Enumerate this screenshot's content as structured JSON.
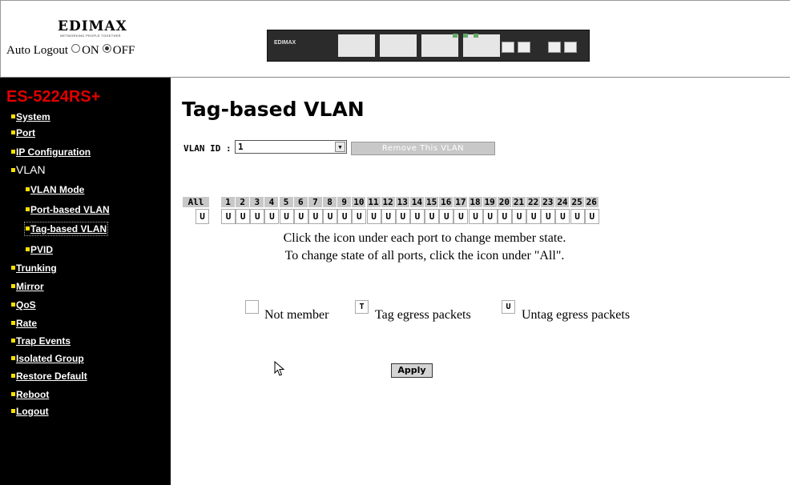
{
  "header": {
    "logo_text": "EDIMAX",
    "logo_tagline": "NETWORKING PEOPLE TOGETHER",
    "auto_logout_label": "Auto Logout",
    "on_label": "ON",
    "off_label": "OFF",
    "auto_logout_value": "OFF"
  },
  "sidebar": {
    "model": "ES-5224RS+",
    "items": [
      {
        "label": "System"
      },
      {
        "label": "Port"
      },
      {
        "label": "IP Configuration"
      },
      {
        "label": "VLAN"
      },
      {
        "label": "VLAN Mode"
      },
      {
        "label": "Port-based VLAN"
      },
      {
        "label": "Tag-based VLAN"
      },
      {
        "label": "PVID"
      },
      {
        "label": "Trunking"
      },
      {
        "label": "Mirror"
      },
      {
        "label": "QoS"
      },
      {
        "label": "Rate"
      },
      {
        "label": "Trap Events"
      },
      {
        "label": "Isolated Group"
      },
      {
        "label": "Restore Default"
      },
      {
        "label": "Reboot"
      },
      {
        "label": "Logout"
      }
    ],
    "selected": "Tag-based VLAN"
  },
  "main": {
    "title": "Tag-based VLAN",
    "vlan_id_label": "VLAN ID :",
    "vlan_id_value": "1",
    "remove_button": "Remove This VLAN",
    "all_label": "All",
    "all_state": "U",
    "ports": [
      "1",
      "2",
      "3",
      "4",
      "5",
      "6",
      "7",
      "8",
      "9",
      "10",
      "11",
      "12",
      "13",
      "14",
      "15",
      "16",
      "17",
      "18",
      "19",
      "20",
      "21",
      "22",
      "23",
      "24",
      "25",
      "26"
    ],
    "port_states": [
      "U",
      "U",
      "U",
      "U",
      "U",
      "U",
      "U",
      "U",
      "U",
      "U",
      "U",
      "U",
      "U",
      "U",
      "U",
      "U",
      "U",
      "U",
      "U",
      "U",
      "U",
      "U",
      "U",
      "U",
      "U",
      "U"
    ],
    "instruction_1": "Click the icon under each port to change member state.",
    "instruction_2": "To change state of all ports, click the icon under \"All\".",
    "legend": {
      "not_member": "Not member",
      "tag_symbol": "T",
      "tag": "Tag egress packets",
      "untag_symbol": "U",
      "untag": "Untag egress packets"
    },
    "apply_button": "Apply"
  },
  "colors": {
    "sidebar_bg": "#000000",
    "model_text": "#e00000",
    "nav_bullet": "#ffe000",
    "header_cell": "#c8c8c8"
  }
}
